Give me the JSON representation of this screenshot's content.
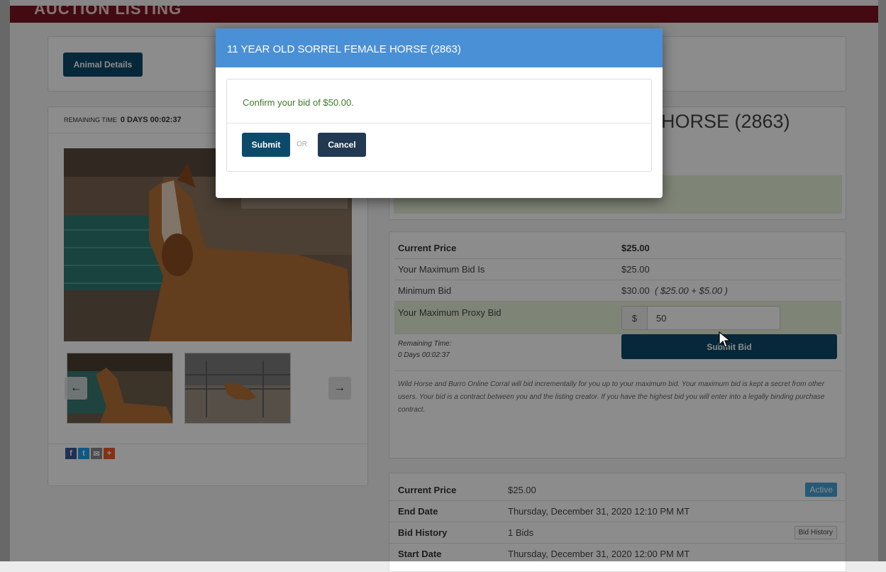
{
  "header": {
    "title": "AUCTION LISTING"
  },
  "tabs": {
    "animal_details": "Animal Details"
  },
  "listing": {
    "remaining_label": "REMAINING TIME",
    "remaining_value": "0 DAYS 00:02:37",
    "title_partial": "HORSE (2863)"
  },
  "bid": {
    "current_price_label": "Current Price",
    "current_price": "$25.00",
    "max_bid_label": "Your Maximum Bid Is",
    "max_bid": "$25.00",
    "min_bid_label": "Minimum Bid",
    "min_bid": "$30.00",
    "min_bid_calc": "( $25.00 + $5.00 )",
    "proxy_label": "Your Maximum Proxy Bid",
    "currency_symbol": "$",
    "proxy_value": "50",
    "remaining_label": "Remaining Time:",
    "remaining_value": "0 Days 00:02:37",
    "submit_label": "Submit Bid",
    "disclaimer": "Wild Horse and Burro Online Corral will bid incrementally for you up to your maximum bid. Your maximum bid is kept a secret from other users.   Your bid is a contract between you and the listing creator. If you have the highest bid you will enter into a legally binding purchase contract."
  },
  "summary": {
    "current_price_label": "Current Price",
    "current_price": "$25.00",
    "status_badge": "Active",
    "end_date_label": "End Date",
    "end_date": "Thursday, December 31, 2020 12:10 PM MT",
    "bid_history_label": "Bid History",
    "bid_history_count": "1 Bids",
    "bid_history_button": "Bid History",
    "start_date_label": "Start Date",
    "start_date": "Thursday, December 31, 2020 12:00 PM MT"
  },
  "modal": {
    "title": "11 YEAR OLD SORREL FEMALE HORSE (2863)",
    "message": "Confirm your bid of $50.00.",
    "submit_label": "Submit",
    "or_label": "OR",
    "cancel_label": "Cancel"
  },
  "icons": {
    "prev": "arrow-left-icon",
    "next": "arrow-right-icon",
    "facebook": "facebook-icon",
    "twitter": "twitter-icon",
    "email": "email-icon",
    "more": "add-share-icon"
  },
  "colors": {
    "brand_bar": "#7a1420",
    "modal_header": "#4a90d6",
    "primary_button": "#0c4a6a",
    "confirm_text": "#3f7a2c",
    "active_badge": "#46a2d8",
    "proxy_row_bg": "#e6f0d8"
  }
}
